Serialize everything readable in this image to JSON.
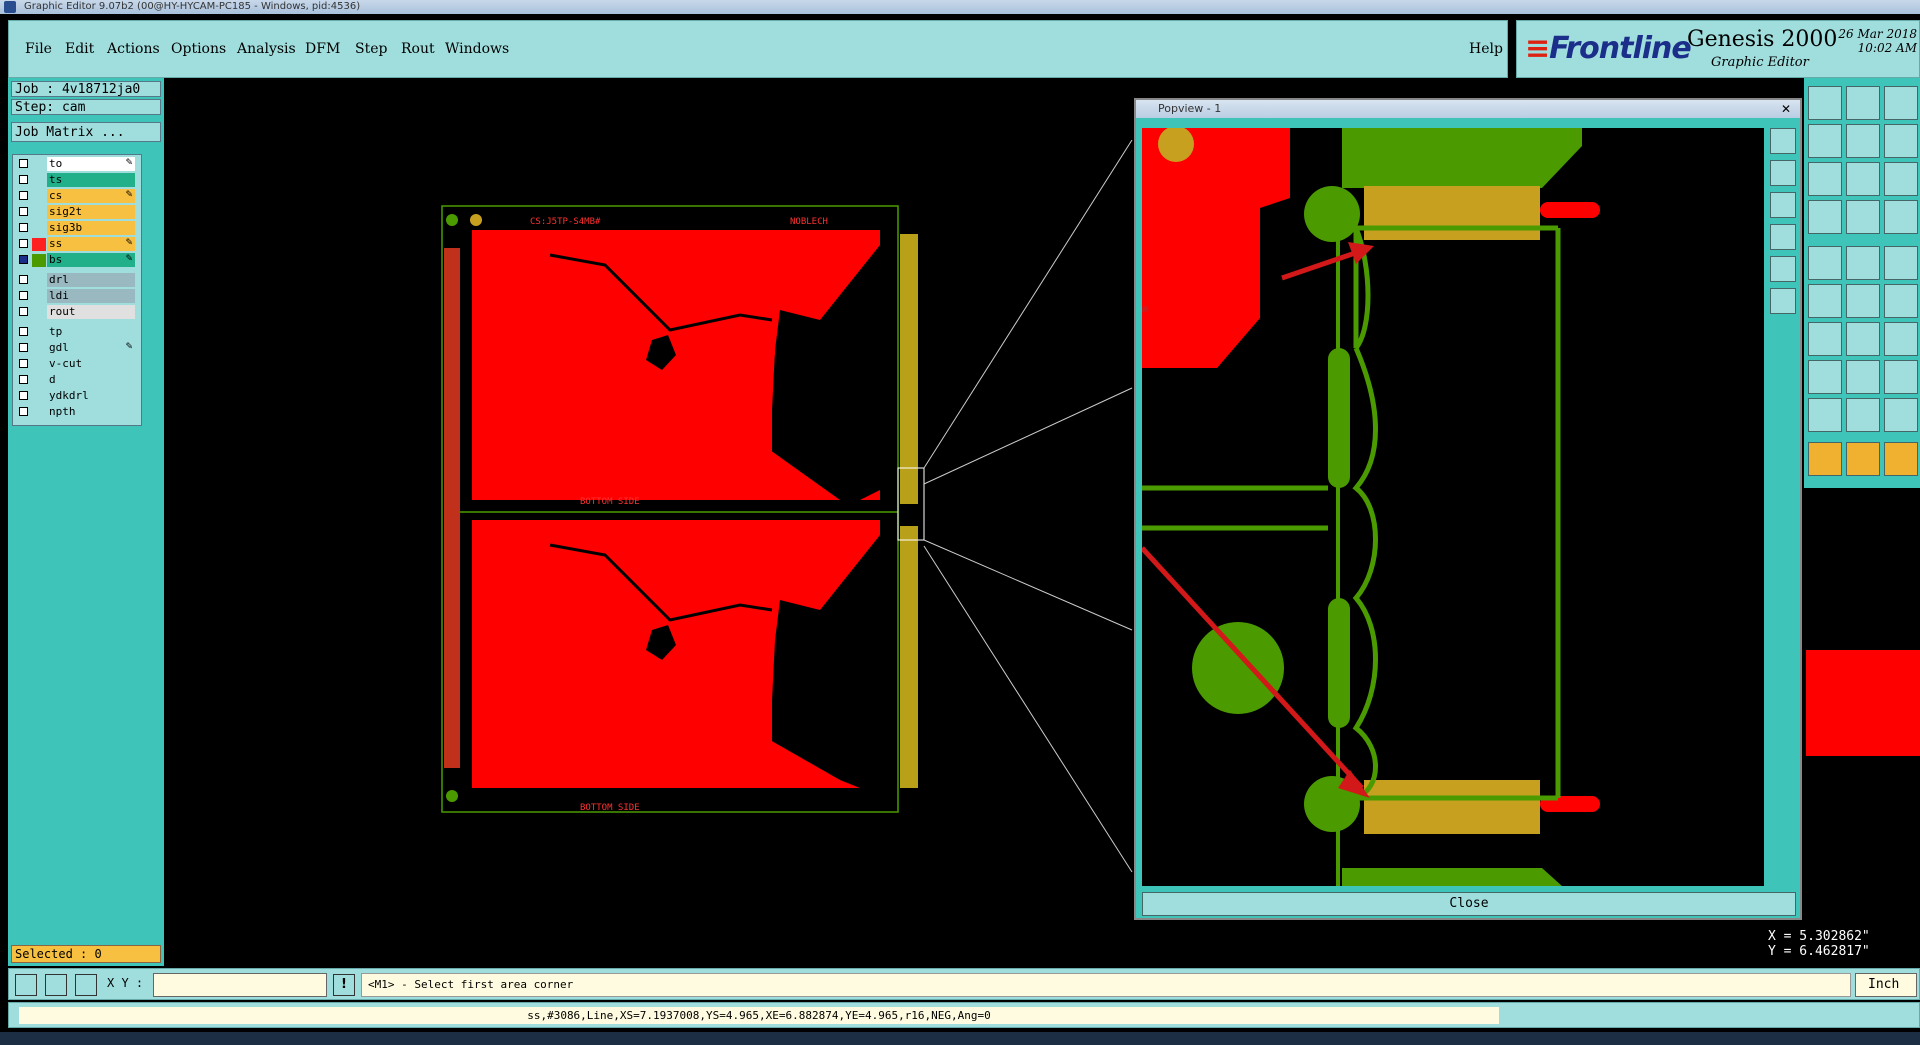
{
  "window": {
    "title": "Graphic Editor 9.07b2 (00@HY-HYCAM-PC185 - Windows, pid:4536)"
  },
  "menu": {
    "items": [
      "File",
      "Edit",
      "Actions",
      "Options",
      "Analysis",
      "DFM",
      "Step",
      "Rout",
      "Windows"
    ],
    "help": "Help"
  },
  "brand": {
    "logo": "Frontline",
    "product": "Genesis 2000",
    "subtitle": "Graphic Editor",
    "date": "26 Mar 2018",
    "time": "10:02 AM"
  },
  "job": {
    "label": "Job : 4v18712ja0",
    "step": "Step: cam",
    "matrix": "Job Matrix ..."
  },
  "layers": [
    {
      "name": "to",
      "color": "#ffffff",
      "editable": true
    },
    {
      "name": "ts",
      "color": "#22b08a",
      "editable": false
    },
    {
      "name": "cs",
      "color": "#f8c040",
      "editable": true
    },
    {
      "name": "sig2t",
      "color": "#f8c040",
      "editable": false
    },
    {
      "name": "sig3b",
      "color": "#f8c040",
      "editable": false
    },
    {
      "name": "ss",
      "color": "#f8c040",
      "editable": true
    },
    {
      "name": "bs",
      "color": "#22b08a",
      "editable": true
    },
    {
      "name": "drl",
      "color": "#9ab8c0",
      "editable": false
    },
    {
      "name": "ldi",
      "color": "#9ab8c0",
      "editable": false
    },
    {
      "name": "rout",
      "color": "#e0e0e0",
      "editable": false
    },
    {
      "name": "tp",
      "color": "#a0dede",
      "editable": false
    },
    {
      "name": "gdl",
      "color": "#a0dede",
      "editable": true
    },
    {
      "name": "v-cut",
      "color": "#a0dede",
      "editable": false
    },
    {
      "name": "d",
      "color": "#a0dede",
      "editable": false
    },
    {
      "name": "ydkdrl",
      "color": "#a0dede",
      "editable": false
    },
    {
      "name": "npth",
      "color": "#a0dede",
      "editable": false
    }
  ],
  "selected": "Selected : 0",
  "popview": {
    "title": "Popview - 1",
    "close_label": "Close"
  },
  "board_text": {
    "top_left": "CS:J5TP-S4MB#",
    "top_right": "NOBLECH",
    "bottom": "BOTTOM SIDE"
  },
  "coords": {
    "x": "X = 5.302862\"",
    "y": "Y = 6.462817\""
  },
  "cmd": {
    "xy_label": "X Y :",
    "xy_value": "",
    "prompt": "<M1> - Select first area corner",
    "unit": "Inch"
  },
  "status": "ss,#3086,Line,XS=7.1937008,YS=4.965,XE=6.882874,YE=4.965,r16,NEG,Ang=0",
  "colors": {
    "panel": "#a0dede",
    "accent": "#3ec4b8",
    "copper": "#ff0000",
    "pad": "#c8a020",
    "trace": "#4a9a00"
  }
}
